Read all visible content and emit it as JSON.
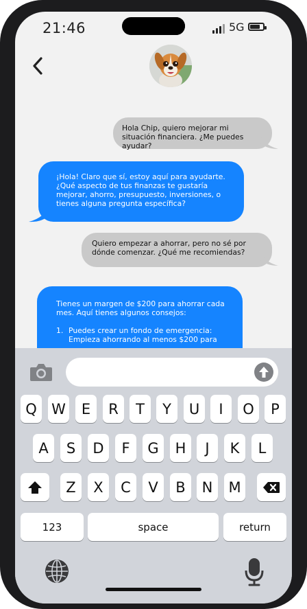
{
  "status": {
    "time": "21:46",
    "network": "5G"
  },
  "header": {
    "back_icon": "chevron-left-icon",
    "avatar_icon": "dog-avatar"
  },
  "messages": [
    {
      "from": "user",
      "text": "Hola Chip, quiero mejorar mi situación financiera. ¿Me puedes ayudar?"
    },
    {
      "from": "bot",
      "text": "¡Hola! Claro que sí, estoy aquí para ayudarte. ¿Qué aspecto de tus finanzas te gustaría mejorar, ahorro, presupuesto, inversiones, o tienes alguna pregunta específica?"
    },
    {
      "from": "user",
      "text": "Quiero empezar a ahorrar, pero no sé por dónde comenzar. ¿Qué me recomiendas?"
    },
    {
      "from": "bot",
      "text": "Tienes un margen de $200 para ahorrar cada mes. Aquí tienes algunos consejos:",
      "list": [
        {
          "num": "1.",
          "text": "Puedes crear un fondo de emergencia: Empieza ahorrando al menos $200 para"
        }
      ]
    }
  ],
  "composer": {
    "camera_icon": "camera-icon",
    "placeholder": "",
    "send_icon": "arrow-up-circle-icon"
  },
  "keyboard": {
    "row1": [
      "Q",
      "W",
      "E",
      "R",
      "T",
      "Y",
      "U",
      "I",
      "O",
      "P"
    ],
    "row2": [
      "A",
      "S",
      "D",
      "F",
      "G",
      "H",
      "J",
      "K",
      "L"
    ],
    "row3": [
      "Z",
      "X",
      "C",
      "V",
      "B",
      "N",
      "M"
    ],
    "numbers_label": "123",
    "space_label": "space",
    "return_label": "return",
    "shift_icon": "shift-icon",
    "delete_icon": "delete-icon",
    "globe_icon": "globe-icon",
    "mic_icon": "microphone-icon"
  },
  "colors": {
    "bot_bubble": "#1584ff",
    "user_bubble": "#c9c9c9",
    "keyboard_bg": "#d1d4da"
  }
}
